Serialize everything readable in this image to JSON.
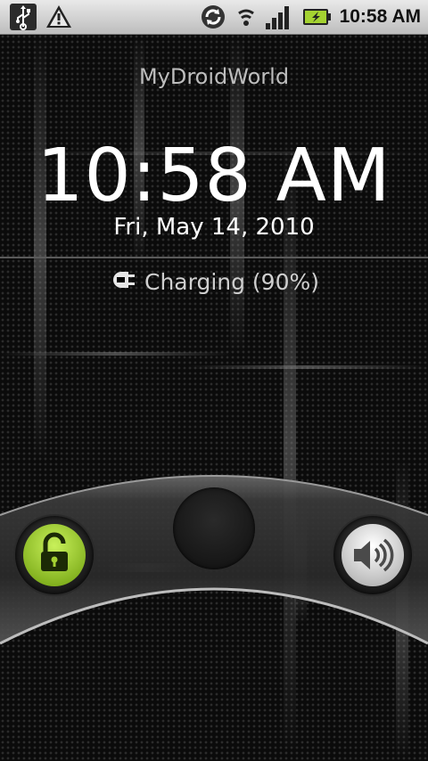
{
  "status_bar": {
    "time": "10:58 AM",
    "left_icons": [
      "usb-icon",
      "warning-icon"
    ],
    "right_icons": [
      "sync-icon",
      "wifi-icon",
      "signal-icon",
      "battery-charging-icon"
    ]
  },
  "lockscreen": {
    "carrier": "MyDroidWorld",
    "time": "10:58 AM",
    "date": "Fri, May 14, 2010",
    "charging_text": "Charging (90%)",
    "battery_level": 0.9
  },
  "slider": {
    "left_icon": "unlock-icon",
    "right_icon": "sound-on-icon"
  },
  "colors": {
    "accent_green": "#a4d231",
    "statusbar_bg": "#d4d4d4"
  }
}
